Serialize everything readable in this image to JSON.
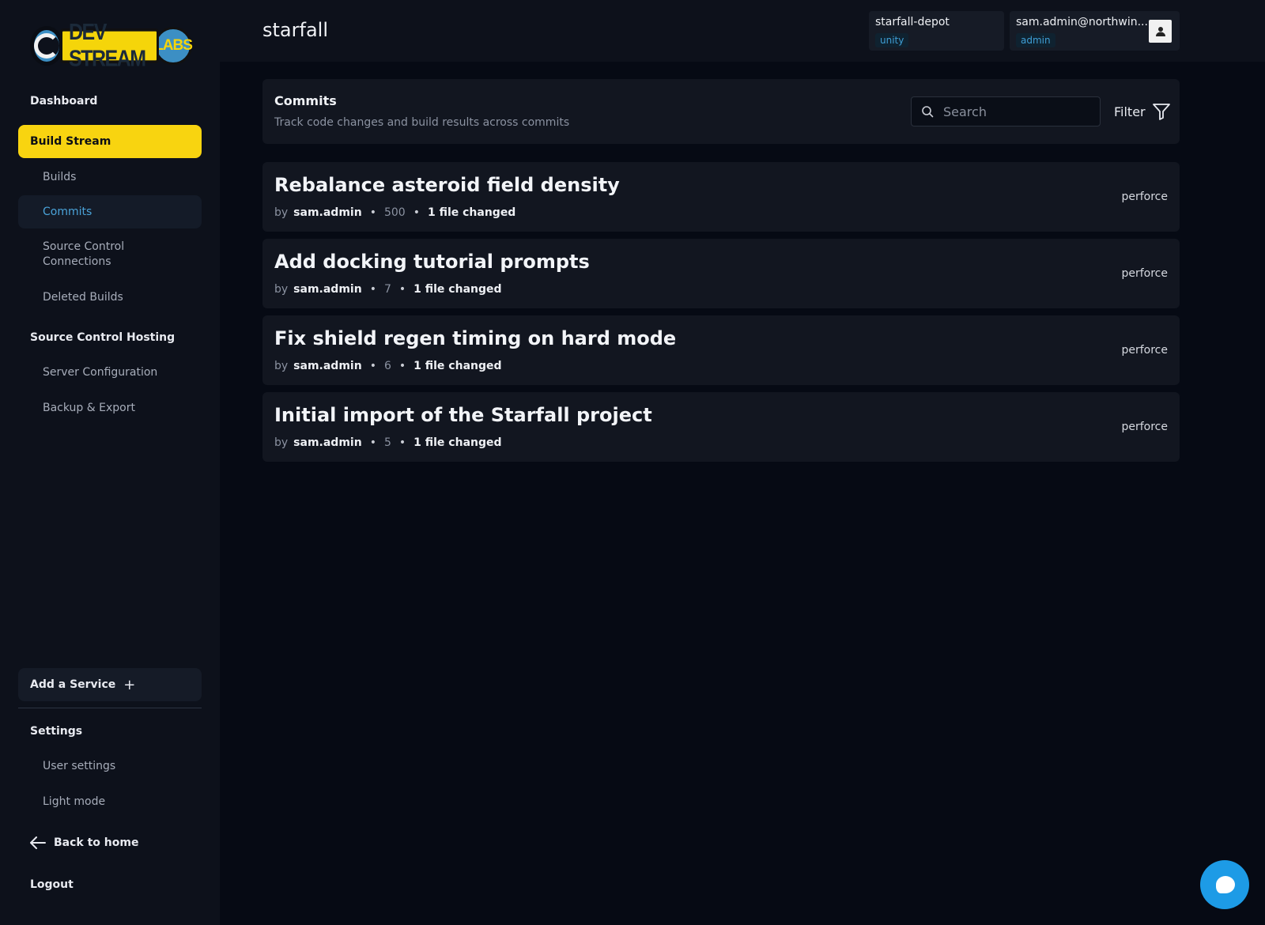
{
  "brand": {
    "logo_text": "DEV STREAM",
    "logo_badge": "LABS"
  },
  "sidebar": {
    "dashboard": "Dashboard",
    "build_stream": "Build Stream",
    "builds": "Builds",
    "commits": "Commits",
    "source_control_connections": "Source Control Connections",
    "deleted_builds": "Deleted Builds",
    "source_control_hosting": "Source Control Hosting",
    "server_configuration": "Server Configuration",
    "backup_export": "Backup & Export",
    "add_service": "Add a Service",
    "add_service_icon": "+",
    "settings": "Settings",
    "user_settings": "User settings",
    "light_mode": "Light mode",
    "back_to_home": "Back to home",
    "logout": "Logout"
  },
  "header": {
    "title": "starfall",
    "depot": {
      "name": "starfall-depot",
      "tag": "unity"
    },
    "user": {
      "email": "sam.admin@northwin...",
      "role": "admin"
    }
  },
  "commits_panel": {
    "title": "Commits",
    "subtitle": "Track code changes and build results across commits",
    "search_placeholder": "Search",
    "filter_label": "Filter"
  },
  "commits": [
    {
      "title": "Rebalance asteroid field density",
      "by": "by",
      "author": "sam.admin",
      "number": "500",
      "files": "1 file changed",
      "source": "perforce"
    },
    {
      "title": "Add docking tutorial prompts",
      "by": "by",
      "author": "sam.admin",
      "number": "7",
      "files": "1 file changed",
      "source": "perforce"
    },
    {
      "title": "Fix shield regen timing on hard mode",
      "by": "by",
      "author": "sam.admin",
      "number": "6",
      "files": "1 file changed",
      "source": "perforce"
    },
    {
      "title": "Initial import of the Starfall project",
      "by": "by",
      "author": "sam.admin",
      "number": "5",
      "files": "1 file changed",
      "source": "perforce"
    }
  ],
  "colors": {
    "accent": "#f8d410",
    "link": "#4aa3d9",
    "background": "#060a14",
    "chat": "#1d9be6"
  }
}
